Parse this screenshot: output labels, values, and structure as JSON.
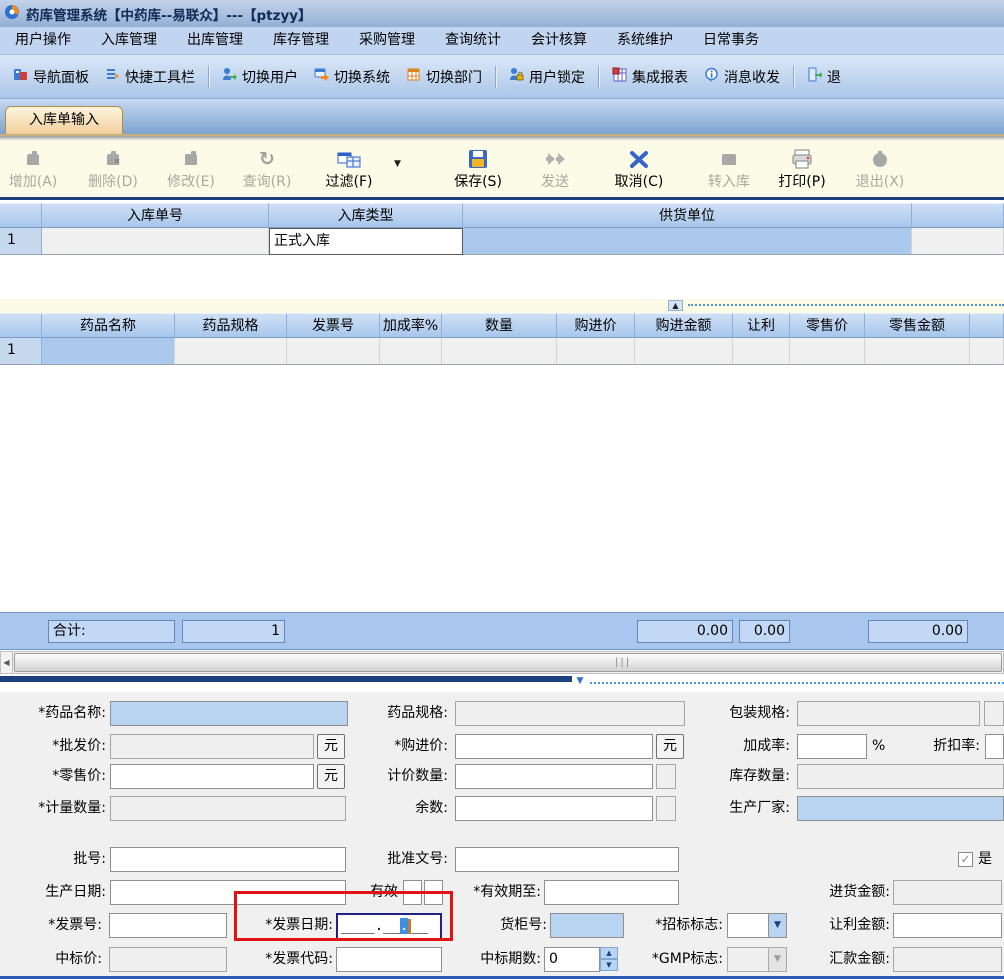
{
  "window": {
    "title": "药库管理系统【中药库--易联众】---【ptzyy】"
  },
  "menu": [
    "用户操作",
    "入库管理",
    "出库管理",
    "库存管理",
    "采购管理",
    "查询统计",
    "会计核算",
    "系统维护",
    "日常事务"
  ],
  "toolbar": [
    {
      "label": "导航面板",
      "icon": "nav-panel-icon"
    },
    {
      "label": "快捷工具栏",
      "icon": "quick-toolbar-icon"
    },
    {
      "label": "切换用户",
      "icon": "switch-user-icon"
    },
    {
      "label": "切换系统",
      "icon": "switch-system-icon"
    },
    {
      "label": "切换部门",
      "icon": "switch-dept-icon"
    },
    {
      "label": "用户锁定",
      "icon": "user-lock-icon"
    },
    {
      "label": "集成报表",
      "icon": "report-icon"
    },
    {
      "label": "消息收发",
      "icon": "message-icon"
    },
    {
      "label": "退",
      "icon": "exit-door-icon"
    }
  ],
  "tab": {
    "label": "入库单输入"
  },
  "actions": [
    {
      "label": "增加(A)",
      "enabled": false,
      "icon": "add-icon"
    },
    {
      "label": "删除(D)",
      "enabled": false,
      "icon": "delete-icon"
    },
    {
      "label": "修改(E)",
      "enabled": false,
      "icon": "modify-icon"
    },
    {
      "label": "查询(R)",
      "enabled": false,
      "icon": "query-icon"
    },
    {
      "label": "过滤(F)",
      "enabled": true,
      "icon": "filter-icon",
      "has_dropdown": true
    },
    {
      "label": "保存(S)",
      "enabled": true,
      "icon": "save-icon"
    },
    {
      "label": "发送",
      "enabled": false,
      "icon": "send-icon"
    },
    {
      "label": "取消(C)",
      "enabled": true,
      "icon": "cancel-icon"
    },
    {
      "label": "转入库",
      "enabled": false,
      "icon": "transfer-icon"
    },
    {
      "label": "打印(P)",
      "enabled": true,
      "icon": "print-icon"
    },
    {
      "label": "退出(X)",
      "enabled": false,
      "icon": "exit-icon"
    }
  ],
  "order_table": {
    "headers": [
      "入库单号",
      "入库类型",
      "供货单位"
    ],
    "row": {
      "num": "1",
      "order_no": "",
      "type": "正式入库",
      "supplier": ""
    }
  },
  "detail_table": {
    "headers": [
      "药品名称",
      "药品规格",
      "发票号",
      "加成率%",
      "数量",
      "购进价",
      "购进金额",
      "让利",
      "零售价",
      "零售金额"
    ],
    "row_num": "1"
  },
  "totals": {
    "label": "合计:",
    "count": "1",
    "amounts": [
      "0.00",
      "0.00",
      "0.00"
    ]
  },
  "form": {
    "drug_name": {
      "label": "*药品名称:",
      "value": ""
    },
    "drug_spec": {
      "label": "药品规格:",
      "value": ""
    },
    "pack_spec": {
      "label": "包装规格:",
      "value": ""
    },
    "wholesale_price": {
      "label": "*批发价:",
      "unit": "元",
      "value": ""
    },
    "purchase_price": {
      "label": "*购进价:",
      "unit": "元",
      "value": ""
    },
    "markup_rate": {
      "label": "加成率:",
      "percent": "%",
      "value": ""
    },
    "discount_rate": {
      "label": "折扣率:",
      "value": ""
    },
    "retail_price": {
      "label": "*零售价:",
      "unit": "元",
      "value": ""
    },
    "pricing_qty": {
      "label": "计价数量:",
      "value": ""
    },
    "stock_qty": {
      "label": "库存数量:",
      "value": ""
    },
    "measure_qty": {
      "label": "*计量数量:",
      "value": ""
    },
    "remainder": {
      "label": "余数:",
      "value": ""
    },
    "manufacturer": {
      "label": "生产厂家:",
      "value": ""
    },
    "batch_no": {
      "label": "批号:",
      "value": ""
    },
    "approval_no": {
      "label": "批准文号:",
      "value": ""
    },
    "yes_checkbox": {
      "label": "是",
      "checked": true,
      "check_glyph": "✓"
    },
    "production_date": {
      "label": "生产日期:",
      "value": ""
    },
    "valid": {
      "label": "有效"
    },
    "valid_until": {
      "label": "*有效期至:",
      "value": ""
    },
    "purchase_amount": {
      "label": "进货金额:",
      "value": ""
    },
    "invoice_no": {
      "label": "*发票号:",
      "value": ""
    },
    "invoice_date": {
      "label": "*发票日期:",
      "mask_left": "____.__",
      "mask_selected": ".",
      "mask_right": "__"
    },
    "cabinet_no": {
      "label": "货柜号:",
      "value": ""
    },
    "bid_flag": {
      "label": "*招标标志:",
      "value": ""
    },
    "rebate_amount": {
      "label": "让利金额:",
      "value": ""
    },
    "bid_price": {
      "label": "中标价:",
      "value": ""
    },
    "invoice_code": {
      "label": "*发票代码:",
      "value": ""
    },
    "bid_periods": {
      "label": "中标期数:",
      "value": "0"
    },
    "gmp_flag": {
      "label": "*GMP标志:",
      "value": ""
    },
    "remittance_amount": {
      "label": "汇款金额:",
      "value": ""
    }
  },
  "colors": {
    "highlight_rect": "#e01212",
    "selected_field": "#b9d4f1",
    "table_header": "#abc8ea",
    "action_bar": "#fbfbe8"
  }
}
